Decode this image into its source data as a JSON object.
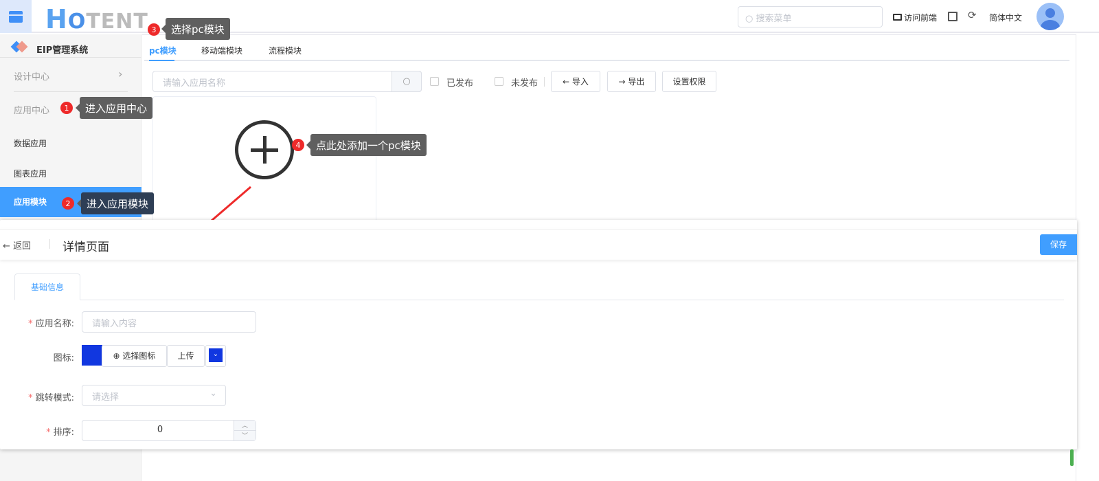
{
  "header": {
    "logo": "HOTENT",
    "search_placeholder": "搜索菜单",
    "visit_frontend": "访问前端",
    "language": "简体中文"
  },
  "sidebar": {
    "system_title": "EIP管理系统",
    "design_center": "设计中心",
    "app_center": "应用中心",
    "items": [
      {
        "label": "数据应用"
      },
      {
        "label": "图表应用"
      },
      {
        "label": "应用模块"
      }
    ]
  },
  "main": {
    "tabs": [
      {
        "label": "pc模块"
      },
      {
        "label": "移动端模块"
      },
      {
        "label": "流程模块"
      }
    ],
    "search_placeholder": "请输入应用名称",
    "published": "已发布",
    "unpublished": "未发布",
    "import_label": "导入",
    "export_label": "导出",
    "permissions_label": "设置权限"
  },
  "dialog": {
    "back": "返回",
    "title": "详情页面",
    "save": "保存",
    "tab": "基础信息",
    "fields": {
      "name_label": "应用名称:",
      "name_placeholder": "请输入内容",
      "icon_label": "图标:",
      "choose_icon": "选择图标",
      "upload": "上传",
      "icon_color": "#1137e0",
      "jump_label": "跳转模式:",
      "jump_placeholder": "请选择",
      "order_label": "排序:",
      "order_value": "0"
    }
  },
  "annotations": [
    {
      "n": "1",
      "text": "进入应用中心"
    },
    {
      "n": "2",
      "text": "进入应用模块"
    },
    {
      "n": "3",
      "text": "选择pc模块"
    },
    {
      "n": "4",
      "text": "点此处添加一个pc模块"
    }
  ],
  "colors": {
    "accent": "#409eff",
    "annotation": "#ee2a2a"
  }
}
